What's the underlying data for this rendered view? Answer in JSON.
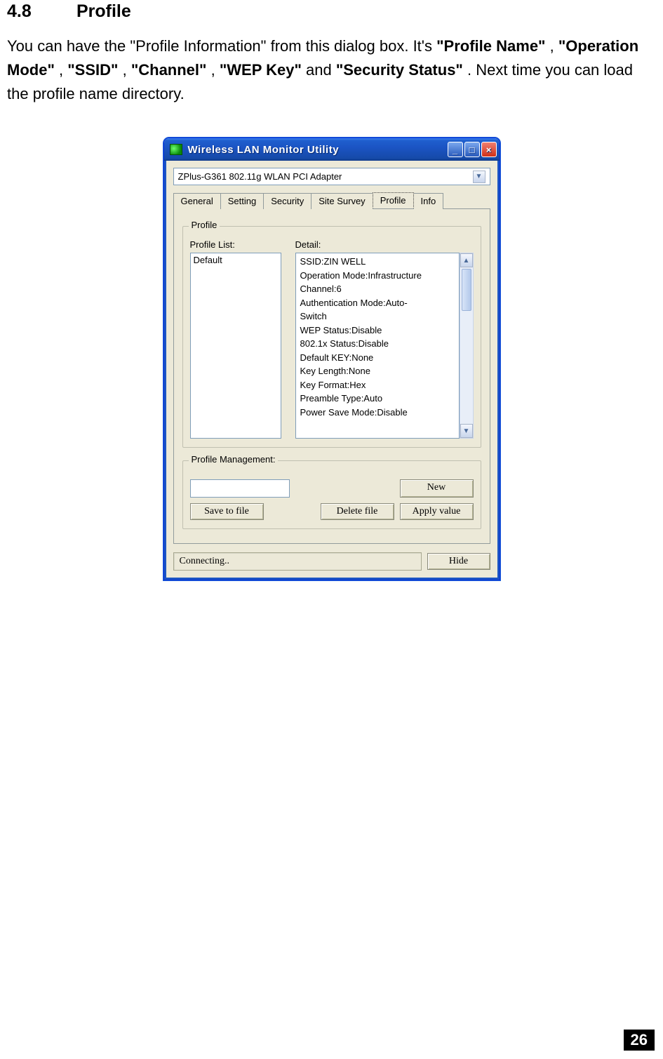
{
  "heading": {
    "number": "4.8",
    "title": "Profile"
  },
  "paragraph": {
    "t1": "You can have the \"Profile Information\" from this dialog box. It's ",
    "b1": "\"Profile Name\"",
    "t2": ", ",
    "b2": "\"Operation Mode\"",
    "t3": ", ",
    "b3": "\"SSID\"",
    "t4": ", ",
    "b4": "\"Channel\"",
    "t5": ", ",
    "b5": "\"WEP Key\"",
    "t6": " and ",
    "b6": "\"Security Status\"",
    "t7": ". Next time you can load the profile name directory."
  },
  "window": {
    "title": "Wireless LAN Monitor Utility",
    "adapter": "ZPlus-G361 802.11g WLAN PCI Adapter",
    "tabs": {
      "general": "General",
      "setting": "Setting",
      "security": "Security",
      "siteSurvey": "Site Survey",
      "profile": "Profile",
      "info": "Info"
    },
    "profileGroup": {
      "label": "Profile",
      "listLabel": "Profile List:",
      "detailLabel": "Detail:",
      "listItem": "Default",
      "details": {
        "l1": "SSID:ZIN WELL",
        "l2": "Operation Mode:Infrastructure",
        "l3": "Channel:6",
        "l4": "Authentication Mode:Auto-",
        "l5": "Switch",
        "l6": "WEP Status:Disable",
        "l7": "802.1x Status:Disable",
        "l8": "Default KEY:None",
        "l9": "Key Length:None",
        "l10": "Key Format:Hex",
        "l11": "Preamble Type:Auto",
        "l12": "Power Save Mode:Disable"
      }
    },
    "mgmtGroup": {
      "label": "Profile Management:",
      "new": "New",
      "save": "Save to file",
      "delete": "Delete file",
      "apply": "Apply value"
    },
    "status": "Connecting..",
    "hide": "Hide"
  },
  "pageNumber": "26"
}
